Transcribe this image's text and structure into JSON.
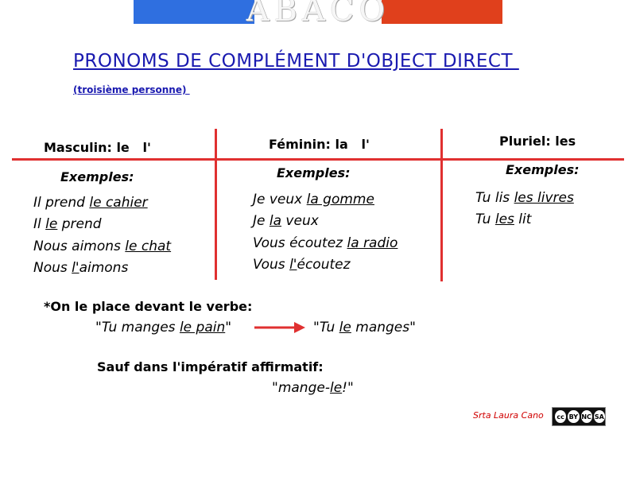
{
  "logo": {
    "text": "ABACO"
  },
  "title": "PRONOMS DE COMPLÉMENT D'OBJECT DIRECT ",
  "subtitle": "(troisième personne) ",
  "columns": [
    {
      "heading": "Masculin: le   l'",
      "examples_label": "Exemples:",
      "lines": [
        [
          {
            "t": "Il prend "
          },
          {
            "t": "le cahier",
            "u": true
          }
        ],
        [
          {
            "t": "Il "
          },
          {
            "t": "le",
            "u": true
          },
          {
            "t": " prend"
          }
        ],
        [
          {
            "t": "Nous aimons "
          },
          {
            "t": "le chat",
            "u": true
          }
        ],
        [
          {
            "t": "Nous "
          },
          {
            "t": "l'",
            "u": true
          },
          {
            "t": "aimons"
          }
        ]
      ]
    },
    {
      "heading": "Féminin: la   l'",
      "examples_label": "Exemples:",
      "lines": [
        [
          {
            "t": "Je veux "
          },
          {
            "t": "la gomme",
            "u": true
          }
        ],
        [
          {
            "t": "Je "
          },
          {
            "t": "la",
            "u": true
          },
          {
            "t": " veux"
          }
        ],
        [
          {
            "t": "Vous écoutez "
          },
          {
            "t": "la radio",
            "u": true
          }
        ],
        [
          {
            "t": "Vous "
          },
          {
            "t": "l'",
            "u": true
          },
          {
            "t": "écoutez"
          }
        ]
      ]
    },
    {
      "heading": "Pluriel: les",
      "examples_label": "Exemples:",
      "lines": [
        [
          {
            "t": "Tu lis "
          },
          {
            "t": "les livres",
            "u": true
          }
        ],
        [
          {
            "t": "Tu "
          },
          {
            "t": "les",
            "u": true
          },
          {
            "t": " lit"
          }
        ]
      ]
    }
  ],
  "rule": {
    "text": "*On le place devant le verbe:",
    "from": [
      {
        "t": "\"Tu manges "
      },
      {
        "t": "le pain",
        "u": true
      },
      {
        "t": "\""
      }
    ],
    "to": [
      {
        "t": "\"Tu "
      },
      {
        "t": "le",
        "u": true
      },
      {
        "t": " manges\""
      }
    ]
  },
  "exception": {
    "text": "Sauf dans l'impératif affirmatif:",
    "example": [
      {
        "t": "\"mange-"
      },
      {
        "t": "le",
        "u": true
      },
      {
        "t": "!\""
      }
    ]
  },
  "credit": "Srta Laura Cano",
  "license": {
    "badges": [
      "cc",
      "BY",
      "NC",
      "SA"
    ]
  },
  "colors": {
    "title": "#1a1ab0",
    "lines": "#e03030",
    "arrow": "#e03030",
    "credit": "#d00000"
  }
}
